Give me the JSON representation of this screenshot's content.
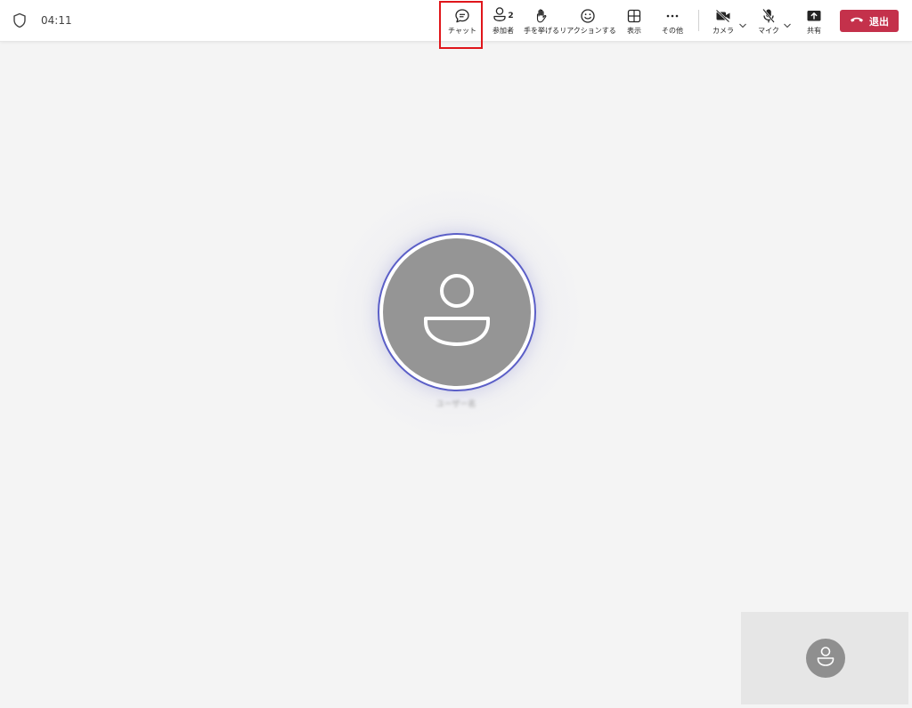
{
  "topbar": {
    "timer": "04:11",
    "shield_icon": "shield-icon",
    "tools": {
      "chat": {
        "label": "チャット",
        "icon": "chat-icon"
      },
      "people": {
        "label": "参加者",
        "count": "2",
        "icon": "people-icon"
      },
      "raise_hand": {
        "label": "手を挙げる",
        "icon": "hand-icon"
      },
      "react": {
        "label": "リアクションする",
        "icon": "smile-icon"
      },
      "view": {
        "label": "表示",
        "icon": "grid-icon"
      },
      "more": {
        "label": "その他",
        "icon": "more-icon"
      },
      "camera": {
        "label": "カメラ",
        "icon": "camera-off-icon"
      },
      "mic": {
        "label": "マイク",
        "icon": "mic-off-icon"
      },
      "share": {
        "label": "共有",
        "icon": "share-icon"
      }
    },
    "leave": {
      "label": "退出",
      "icon": "phone-hangup-icon"
    }
  },
  "stage": {
    "participant_name": "ユーザー名",
    "self_view_icon": "person-icon"
  },
  "colors": {
    "accent": "#5b5fc7",
    "leave": "#c4314b",
    "highlight": "#e0161b",
    "avatar_bg": "#959595",
    "stage_bg": "#f4f4f4"
  }
}
